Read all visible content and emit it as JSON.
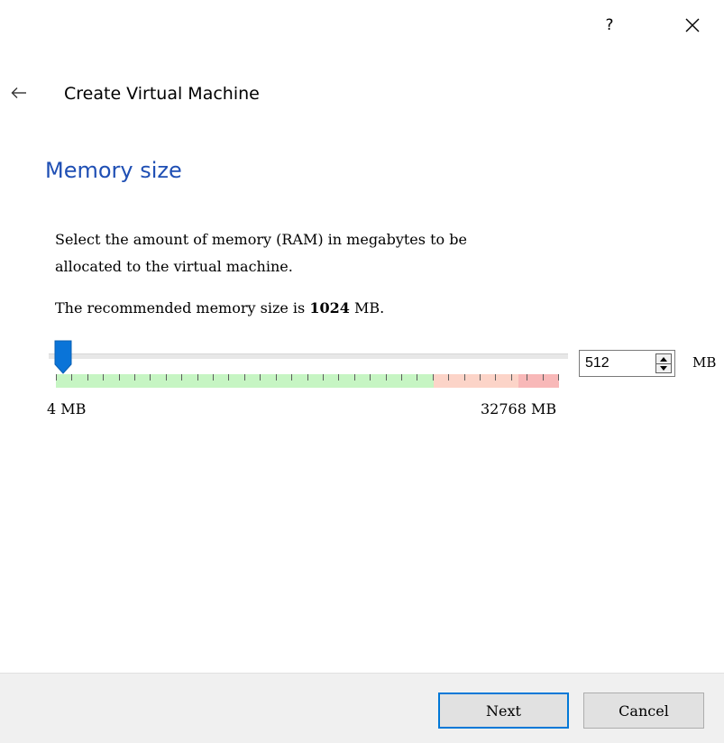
{
  "titlebar": {
    "help_label": "?",
    "close_icon": "close-icon"
  },
  "nav": {
    "back_icon": "back-arrow-icon",
    "title": "Create Virtual Machine"
  },
  "page": {
    "heading": "Memory size",
    "description": "Select the amount of memory (RAM) in megabytes to be\nallocated to the virtual machine.",
    "recommend_prefix": "The recommended memory size is ",
    "recommend_value": "1024",
    "recommend_suffix": " MB."
  },
  "memory": {
    "value": "512",
    "unit": "MB",
    "min_label": "4 MB",
    "max_label": "32768 MB",
    "slider_fraction": 0.015,
    "zones": [
      {
        "name": "safe",
        "end_fraction": 0.75,
        "color": "#c6f5c3"
      },
      {
        "name": "warning",
        "end_fraction": 0.92,
        "color": "#fcd4c8"
      },
      {
        "name": "danger",
        "end_fraction": 1.0,
        "color": "#f8b8b8"
      }
    ],
    "tick_count": 33
  },
  "colors": {
    "heading": "#1f4fb4",
    "accent": "#0078d7",
    "thumb": "#0a74d8"
  },
  "footer": {
    "next_label": "Next",
    "cancel_label": "Cancel"
  }
}
